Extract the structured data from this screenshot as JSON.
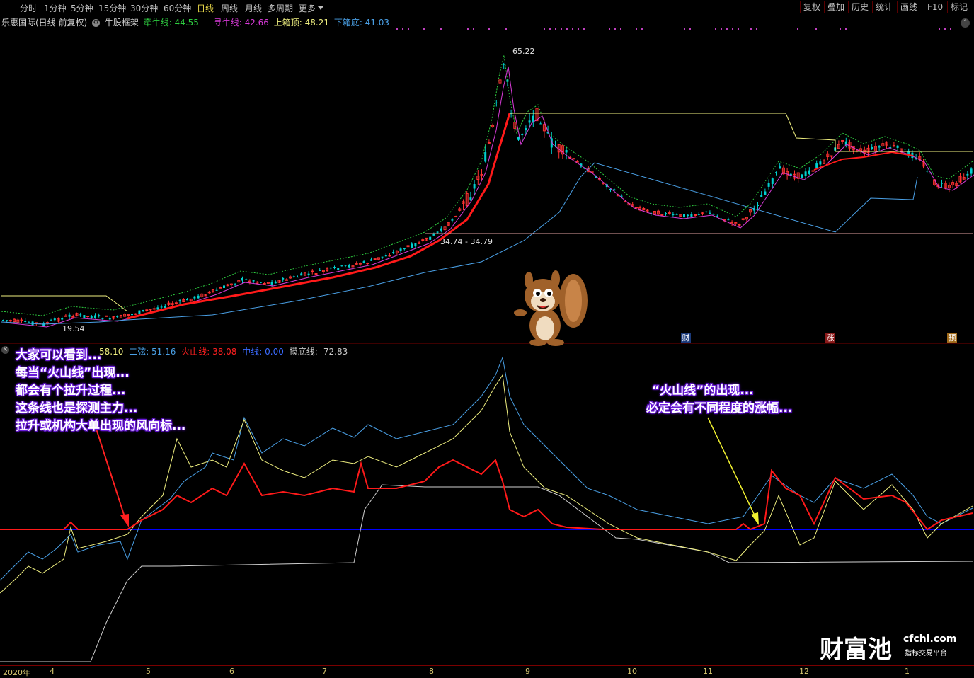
{
  "toolbar": {
    "periods": [
      "分时",
      "1分钟",
      "5分钟",
      "15分钟",
      "30分钟",
      "60分钟",
      "日线",
      "周线",
      "月线",
      "多周期",
      "更多"
    ],
    "active": "日线",
    "right_buttons": [
      "复权",
      "叠加",
      "历史",
      "统计",
      "画线",
      "F10",
      "标记"
    ]
  },
  "main_legend": {
    "stock": "乐惠国际(日线 前复权)",
    "indicator": "牛股框架",
    "l1": "牵牛线: 44.55",
    "l2": "寻牛线: 42.66",
    "l3": "上箱顶: 48.21",
    "l4": "下箱底: 41.03"
  },
  "price_labels": {
    "high": "65.22",
    "range": "34.74 - 34.79",
    "low": "19.54"
  },
  "events": {
    "e1": "财",
    "e2": "涨",
    "e3": "预"
  },
  "indicator_legend": {
    "v1": "58.10",
    "v2": "二弦: 51.16",
    "v3": "火山线: 38.08",
    "v4": "中线: 0.00",
    "v5": "摸底线: -72.83"
  },
  "note_left": {
    "l1": "大家可以看到...",
    "l2": "每当“火山线”出现...",
    "l3": "都会有个拉升过程...",
    "l4": "这条线也是探测主力...",
    "l5": "拉升或机构大单出现的风向标..."
  },
  "note_right": {
    "l1": "“火山线”的出现...",
    "l2": "必定会有不同程度的涨幅..."
  },
  "date_axis": [
    "2020年",
    "4",
    "5",
    "6",
    "7",
    "8",
    "9",
    "10",
    "11",
    "12",
    "1"
  ],
  "watermark": {
    "brand": "财富池",
    "domain": "cfchi.com",
    "tagline": "指标交易平台"
  },
  "colors": {
    "up": "#ff3232",
    "down": "#00d0d0",
    "red_line": "#ff1a1a",
    "blue_line": "#4aa0e6",
    "magenta_line": "#d83ad8",
    "yellow_line": "#f0f080",
    "mid_line": "#0000ff"
  }
}
